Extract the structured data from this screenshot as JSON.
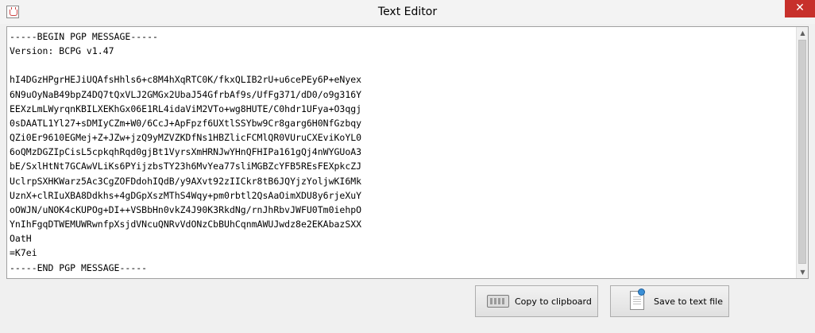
{
  "window": {
    "title": "Text Editor",
    "close_glyph": "✕",
    "app_icon": "java-coffee-cup-icon"
  },
  "editor": {
    "lines": [
      "-----BEGIN PGP MESSAGE-----",
      "Version: BCPG v1.47",
      "",
      "hI4DGzHPgrHEJiUQAfsHhls6+c8M4hXqRTC0K/fkxQLIB2rU+u6cePEy6P+eNyex",
      "6N9uOyNaB49bpZ4DQ7tQxVLJ2GMGx2UbaJ54GfrbAf9s/UfFg371/dD0/o9g316Y",
      "EEXzLmLWyrqnKBILXEKhGx06E1RL4idaViM2VTo+wg8HUTE/C0hdr1UFya+O3qgj",
      "0sDAATL1Yl27+sDMIyCZm+W0/6CcJ+ApFpzf6UXtlSSYbw9Cr8garg6H0NfGzbqy",
      "QZi0Er9610EGMej+Z+JZw+jzQ9yMZVZKDfNs1HBZlicFCMlQR0VUruCXEviKoYL0",
      "6oQMzDGZIpCisL5cpkqhRqd0gjBt1VyrsXmHRNJwYHnQFHIPa161gQj4nWYGUoA3",
      "bE/SxlHtNt7GCAwVLiKs6PYijzbsTY23h6MvYea77sliMGBZcYFB5REsFEXpkcZJ",
      "UclrpSXHKWarz5Ac3CgZOFDdohIQdB/y9AXvt92zIICkr8tB6JQYjzYoljwKI6Mk",
      "UznX+clRIuXBA8Ddkhs+4gDGpXszMThS4Wqy+pm0rbtl2QsAaOimXDU8y6rjeXuY",
      "oOWJN/uNOK4cKUPOg+DI++VSBbHn0vkZ4J90K3RkdNg/rnJhRbvJWFU0Tm0iehpO",
      "YnIhFgqDTWEMUWRwnfpXsjdVNcuQNRvVdONzCbBUhCqnmAWUJwdz8e2EKAbazSXX",
      "OatH",
      "=K7ei",
      "-----END PGP MESSAGE-----"
    ]
  },
  "buttons": {
    "copy_label": "Copy to clipboard",
    "copy_icon": "keyboard-icon",
    "save_label": "Save to text file",
    "save_icon": "pinned-note-icon"
  },
  "scrollbar": {
    "up_glyph": "▲",
    "down_glyph": "▼"
  },
  "colors": {
    "close_button": "#c7302b",
    "titlebar": "#f3f3f3"
  }
}
